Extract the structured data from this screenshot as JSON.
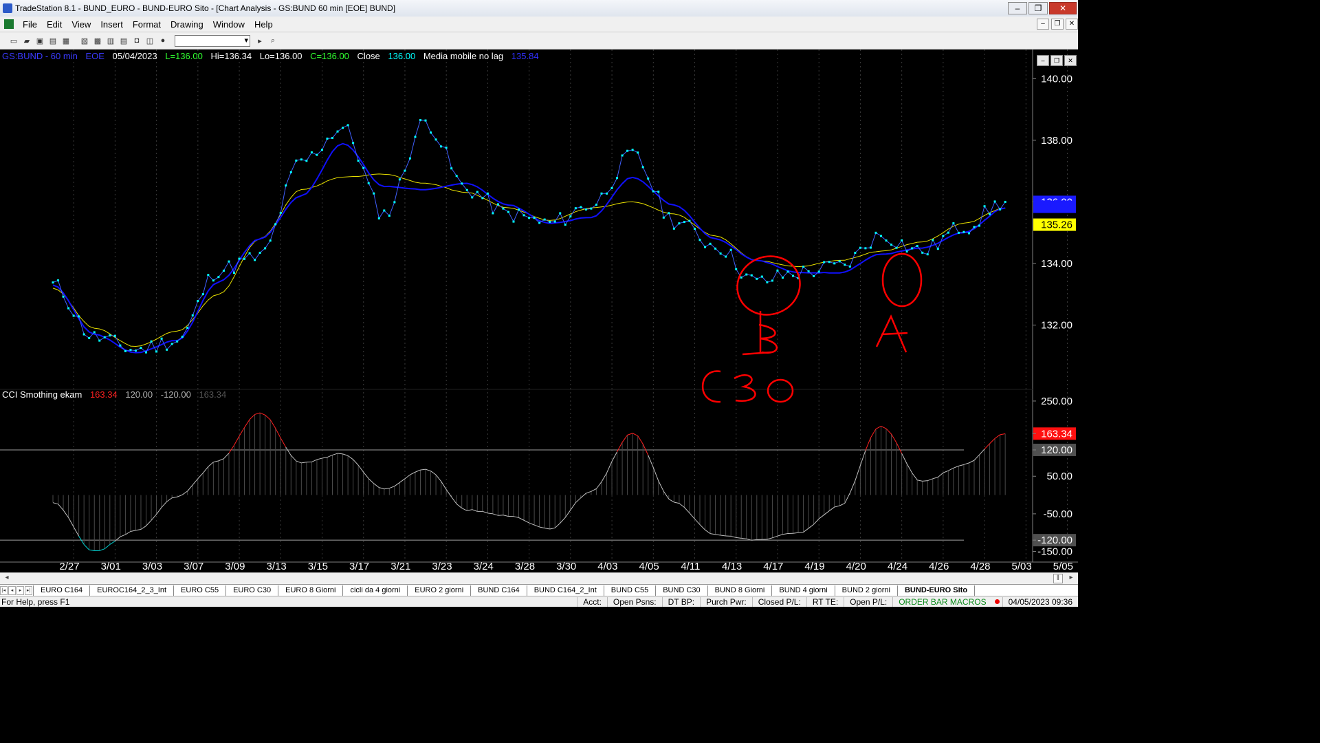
{
  "window": {
    "title": "TradeStation 8.1 - BUND_EURO - BUND-EURO Sito - [Chart Analysis - GS:BUND  60 min  [EOE] BUND]",
    "min": "–",
    "max": "❐",
    "close": "✕"
  },
  "menu": {
    "items": [
      "File",
      "Edit",
      "View",
      "Insert",
      "Format",
      "Drawing",
      "Window",
      "Help"
    ]
  },
  "readout": {
    "symbol": "GS:BUND - 60 min",
    "eoe": "EOE",
    "date": "05/04/2023",
    "low_open": "L=136.00",
    "high": "Hi=136.34",
    "low": "Lo=136.00",
    "close": "C=136.00",
    "close_label": "Close",
    "close_val": "136.00",
    "indicator_name": "Media mobile no lag",
    "indicator_val": "135.84"
  },
  "cci_readout": {
    "name": "CCI Smothing ekam",
    "v1": "163.34",
    "v2": "120.00",
    "v3": "-120.00",
    "v4": "163.34"
  },
  "colors": {
    "price": "#00ffff",
    "blue_ma": "#1010ff",
    "yellow_ma": "#e8e000",
    "cci_hi": "#ff2020",
    "cci_lo": "#00d0d0",
    "cci_mid": "#c0c0c0",
    "annotation": "#ff0000"
  },
  "annotations": {
    "b": "B",
    "c30": "C30",
    "a": "A"
  },
  "chart_data": [
    {
      "type": "line",
      "title": "GS:BUND - 60 min",
      "ylim": [
        130.0,
        140.5
      ],
      "yticks": [
        132,
        134,
        136,
        138,
        140
      ],
      "ytick_labels": [
        "132.00",
        "134.00",
        "136.00",
        "138.00",
        "140.00"
      ],
      "x": [
        "2/27",
        "3/01",
        "3/03",
        "3/07",
        "3/09",
        "3/13",
        "3/15",
        "3/17",
        "3/21",
        "3/23",
        "3/24",
        "3/28",
        "3/30",
        "4/03",
        "4/05",
        "4/11",
        "4/13",
        "4/17",
        "4/19",
        "4/20",
        "4/24",
        "4/26",
        "4/28",
        "5/03",
        "5/05"
      ],
      "series": [
        {
          "name": "Close",
          "values": [
            133.3,
            131.6,
            131.2,
            131.5,
            133.8,
            134.2,
            137.3,
            138.4,
            135.6,
            138.6,
            136.4,
            135.6,
            135.3,
            135.9,
            137.5,
            135.4,
            134.6,
            133.4,
            133.7,
            133.9,
            134.9,
            134.4,
            135.2,
            136.0
          ]
        },
        {
          "name": "Media mobile no lag",
          "values": [
            133.3,
            131.7,
            131.1,
            131.5,
            133.4,
            134.8,
            136.2,
            137.9,
            136.5,
            136.4,
            136.6,
            135.9,
            135.3,
            135.5,
            136.8,
            135.9,
            134.8,
            134.1,
            133.7,
            133.7,
            134.3,
            134.5,
            135.0,
            135.8
          ]
        },
        {
          "name": "Yellow MA",
          "values": [
            133.2,
            131.9,
            131.3,
            131.8,
            133.0,
            134.8,
            136.4,
            136.8,
            136.9,
            136.6,
            136.3,
            135.8,
            135.4,
            135.8,
            136.0,
            135.6,
            134.9,
            134.1,
            133.9,
            134.1,
            134.4,
            134.7,
            135.3,
            135.8
          ]
        }
      ],
      "last_labels": [
        "136.00",
        "135.84",
        "135.26"
      ]
    },
    {
      "type": "area",
      "title": "CCI Smothing ekam",
      "ylim": [
        -160,
        270
      ],
      "yticks": [
        250,
        163.34,
        120,
        50,
        -50,
        -120,
        -150
      ],
      "ytick_labels": [
        "250.00",
        "163.34",
        "120.00",
        "50.00",
        "-50.00",
        "-120.00",
        "-150.00"
      ],
      "levels": [
        120,
        -120
      ],
      "x": [
        "2/27",
        "3/01",
        "3/03",
        "3/07",
        "3/09",
        "3/13",
        "3/15",
        "3/17",
        "3/21",
        "3/23",
        "3/24",
        "3/28",
        "3/30",
        "4/03",
        "4/05",
        "4/11",
        "4/13",
        "4/17",
        "4/19",
        "4/20",
        "4/24",
        "4/26",
        "4/28",
        "5/03",
        "5/05"
      ],
      "series": [
        {
          "name": "CCI Smothing ekam",
          "values": [
            -20,
            -150,
            -95,
            -5,
            90,
            220,
            85,
            110,
            15,
            70,
            -40,
            -55,
            -90,
            10,
            165,
            -20,
            -105,
            -120,
            -100,
            -30,
            185,
            35,
            80,
            163
          ]
        }
      ]
    }
  ],
  "tabs": [
    "EURO C164",
    "EUROC164_2_3_Int",
    "EURO C55",
    "EURO C30",
    "EURO 8 Giorni",
    "cicli da 4 giorni",
    "EURO 2 giorni",
    "BUND C164",
    "BUND C164_2_Int",
    "BUND C55",
    "BUND  C30",
    "BUND 8 Giorni",
    "BUND 4 giorni",
    "BUND 2 giorni",
    "BUND-EURO Sito"
  ],
  "status": {
    "help": "For Help, press F1",
    "fields": [
      "Acct:",
      "Open Psns:",
      "DT BP:",
      "Purch Pwr:",
      "Closed P/L:",
      "RT TE:",
      "Open P/L:"
    ],
    "macros": "ORDER BAR MACROS",
    "datetime": "04/05/2023 09:36"
  }
}
